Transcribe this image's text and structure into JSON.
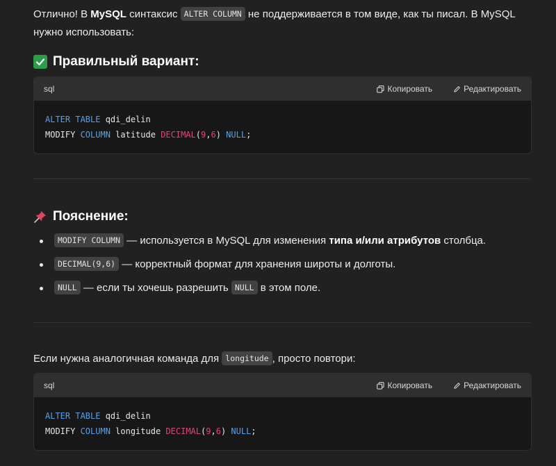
{
  "intro": {
    "t1": "Отлично! В ",
    "b1": "MySQL",
    "t2": " синтаксис ",
    "code1": "ALTER COLUMN",
    "t3": " не поддерживается в том виде, как ты писал. В MySQL",
    "t4": "нужно использовать:"
  },
  "heading1": {
    "icon": "check-mark-icon",
    "text": "Правильный вариант:"
  },
  "code_block_1": {
    "lang": "sql",
    "copy_label": "Копировать",
    "edit_label": "Редактировать",
    "line1": {
      "kw1": "ALTER TABLE",
      "rest": " qdi_delin"
    },
    "line2": {
      "p1": "MODIFY ",
      "kw1": "COLUMN",
      "p2": " latitude ",
      "fn": "DECIMAL",
      "p3": "(",
      "n1": "9",
      "p4": ",",
      "n2": "6",
      "p5": ") ",
      "kw2": "NULL",
      "p6": ";"
    }
  },
  "heading2": {
    "icon": "pushpin-icon",
    "text": "Пояснение:"
  },
  "bullets": [
    {
      "code": "MODIFY COLUMN",
      "t1": " — используется в MySQL для изменения ",
      "b": "типа и/или атрибутов",
      "t2": " столбца."
    },
    {
      "code": "DECIMAL(9,6)",
      "t1": " — корректный формат для хранения широты и долготы."
    },
    {
      "code": "NULL",
      "t1": " — если ты хочешь разрешить ",
      "code2": "NULL",
      "t2": " в этом поле."
    }
  ],
  "para2": {
    "t1": "Если нужна аналогичная команда для ",
    "code": "longitude",
    "t2": ", просто повтори:"
  },
  "code_block_2": {
    "lang": "sql",
    "copy_label": "Копировать",
    "edit_label": "Редактировать",
    "line1": {
      "kw1": "ALTER TABLE",
      "rest": " qdi_delin"
    },
    "line2": {
      "p1": "MODIFY ",
      "kw1": "COLUMN",
      "p2": " longitude ",
      "fn": "DECIMAL",
      "p3": "(",
      "n1": "9",
      "p4": ",",
      "n2": "6",
      "p5": ") ",
      "kw2": "NULL",
      "p6": ";"
    }
  },
  "colors": {
    "background": "#212121",
    "code_bg": "#171717",
    "keyword": "#5aa0e6",
    "function": "#e6427a",
    "check_green": "#2e9d4a"
  }
}
